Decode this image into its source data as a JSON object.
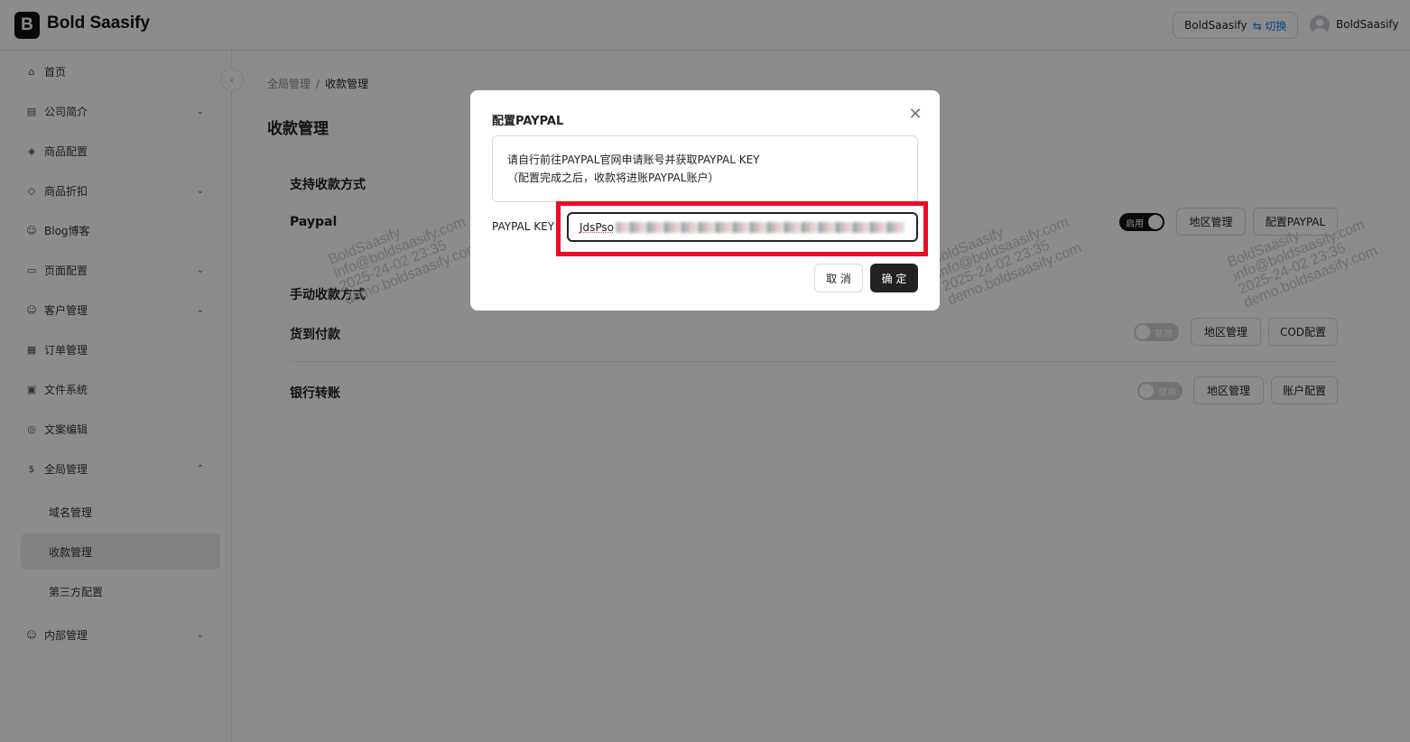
{
  "header": {
    "logo_letter": "B",
    "brand": "Bold Saasify",
    "tenant_name": "BoldSaasify",
    "tenant_switch": "⇆ 切换",
    "user_name": "BoldSaasify"
  },
  "sidebar": {
    "collapse_icon": "‹",
    "items": [
      {
        "label": "首页",
        "icon": "⌂",
        "icon_name": "home-icon"
      },
      {
        "label": "公司简介",
        "icon": "▤",
        "icon_name": "building-icon",
        "chevron": "⌄"
      },
      {
        "label": "商品配置",
        "icon": "◈",
        "icon_name": "box-icon"
      },
      {
        "label": "商品折扣",
        "icon": "◇",
        "icon_name": "tag-icon",
        "chevron": "⌄"
      },
      {
        "label": "Blog博客",
        "icon": "☺",
        "icon_name": "users-icon"
      },
      {
        "label": "页面配置",
        "icon": "▭",
        "icon_name": "monitor-icon",
        "chevron": "⌄"
      },
      {
        "label": "客户管理",
        "icon": "☺",
        "icon_name": "customers-icon",
        "chevron": "⌄"
      },
      {
        "label": "订单管理",
        "icon": "▦",
        "icon_name": "order-icon"
      },
      {
        "label": "文件系统",
        "icon": "▣",
        "icon_name": "file-icon"
      },
      {
        "label": "文案编辑",
        "icon": "◎",
        "icon_name": "globe-icon"
      },
      {
        "label": "全局管理",
        "icon": "$",
        "icon_name": "dollar-icon",
        "chevron": "⌃"
      },
      {
        "label": "域名管理"
      },
      {
        "label": "收款管理"
      },
      {
        "label": "第三方配置"
      },
      {
        "label": "内部管理",
        "icon": "☺",
        "icon_name": "team-icon",
        "chevron": "⌄"
      }
    ]
  },
  "breadcrumb": {
    "parent": "全局管理",
    "separator": "/",
    "current": "收款管理"
  },
  "page_title": "收款管理",
  "support_section": {
    "title": "支持收款方式",
    "paypal": {
      "label": "Paypal",
      "toggle": "启用",
      "region_btn": "地区管理",
      "config_btn": "配置PAYPAL"
    }
  },
  "manual_section": {
    "title": "手动收款方式",
    "cod": {
      "label": "货到付款",
      "toggle": "禁用",
      "region_btn": "地区管理",
      "config_btn": "COD配置"
    },
    "bank": {
      "label": "银行转账",
      "toggle": "禁用",
      "region_btn": "地区管理",
      "config_btn": "账户配置"
    }
  },
  "watermark": {
    "line1": "BoldSaasify",
    "line2": "info@boldsaasify.com",
    "line3": "2025-24-02 23:35",
    "line4": "demo.boldsaasify.com"
  },
  "modal": {
    "title": "配置PAYPAL",
    "close_icon": "✕",
    "notice_line1": "请自行前往PAYPAL官网申请账号并获取PAYPAL KEY",
    "notice_line2": "（配置完成之后，收款将进账PAYPAL账户）",
    "key_label": "PAYPAL KEY",
    "key_value_visible": "JdsPso",
    "cancel": "取 消",
    "ok": "确 定",
    "highlight_color": "#ee0a24"
  }
}
